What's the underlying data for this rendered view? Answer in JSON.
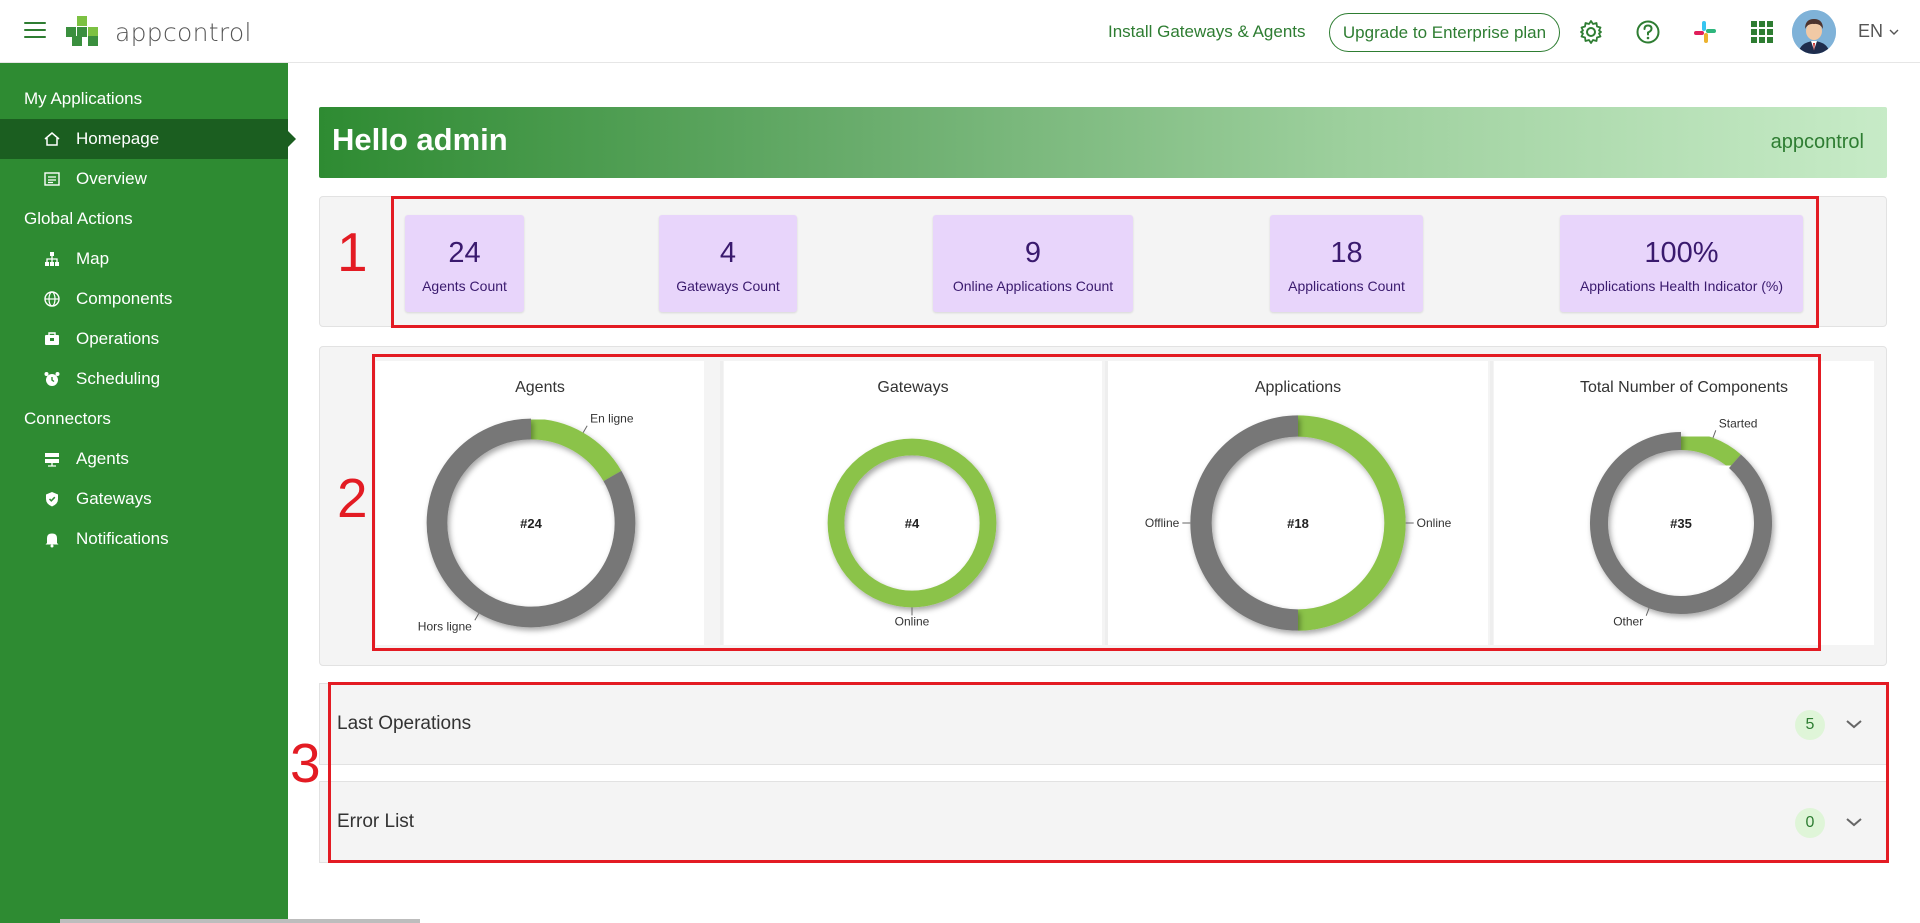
{
  "topbar": {
    "brand": "appcontrol",
    "install_link": "Install Gateways & Agents",
    "upgrade_button": "Upgrade to Enterprise plan",
    "language": "EN",
    "icons": [
      "menu-icon",
      "settings-icon",
      "help-icon",
      "slack-icon",
      "apps-grid-icon",
      "user-avatar",
      "chevron-down-icon"
    ]
  },
  "sidebar": {
    "sections": [
      {
        "label": "My Applications",
        "items": [
          {
            "label": "Homepage",
            "icon": "home-icon",
            "active": true
          },
          {
            "label": "Overview",
            "icon": "list-icon",
            "active": false
          }
        ]
      },
      {
        "label": "Global Actions",
        "items": [
          {
            "label": "Map",
            "icon": "sitemap-icon",
            "active": false
          },
          {
            "label": "Components",
            "icon": "globe-icon",
            "active": false
          },
          {
            "label": "Operations",
            "icon": "toolbox-icon",
            "active": false
          },
          {
            "label": "Scheduling",
            "icon": "alarm-clock-icon",
            "active": false
          }
        ]
      },
      {
        "label": "Connectors",
        "items": [
          {
            "label": "Agents",
            "icon": "server-icon",
            "active": false
          },
          {
            "label": "Gateways",
            "icon": "shield-icon",
            "active": false
          },
          {
            "label": "Notifications",
            "icon": "bell-icon",
            "active": false
          }
        ]
      }
    ]
  },
  "banner": {
    "title": "Hello admin",
    "brand": "appcontrol"
  },
  "kpis": [
    {
      "value": "24",
      "label": "Agents Count"
    },
    {
      "value": "4",
      "label": "Gateways Count"
    },
    {
      "value": "9",
      "label": "Online Applications Count"
    },
    {
      "value": "18",
      "label": "Applications Count"
    },
    {
      "value": "100%",
      "label": "Applications Health Indicator (%)"
    }
  ],
  "chart_data": [
    {
      "type": "pie",
      "title": "Agents",
      "center_label": "#24",
      "slices": [
        {
          "label": "En ligne",
          "value": 4,
          "color": "#8bc34a"
        },
        {
          "label": "Hors ligne",
          "value": 20,
          "color": "#777777"
        }
      ]
    },
    {
      "type": "pie",
      "title": "Gateways",
      "center_label": "#4",
      "slices": [
        {
          "label": "Online",
          "value": 4,
          "color": "#8bc34a"
        }
      ]
    },
    {
      "type": "pie",
      "title": "Applications",
      "center_label": "#18",
      "slices": [
        {
          "label": "Online",
          "value": 9,
          "color": "#8bc34a"
        },
        {
          "label": "Offline",
          "value": 9,
          "color": "#777777"
        }
      ]
    },
    {
      "type": "pie",
      "title": "Total Number of Components",
      "center_label": "#35",
      "slices": [
        {
          "label": "Started",
          "value": 4,
          "color": "#8bc34a"
        },
        {
          "label": "Other",
          "value": 31,
          "color": "#777777"
        }
      ]
    }
  ],
  "accordion": [
    {
      "title": "Last Operations",
      "count": "5"
    },
    {
      "title": "Error List",
      "count": "0"
    }
  ],
  "annotations": [
    "1",
    "2",
    "3"
  ],
  "colors": {
    "sidebar": "#2e8b32",
    "sidebar_active": "#1b5e20",
    "accent": "#2e7d32",
    "kpi_card": "#e8d5fb",
    "highlight": "#e31b23",
    "online": "#8bc34a",
    "offline": "#777777"
  }
}
